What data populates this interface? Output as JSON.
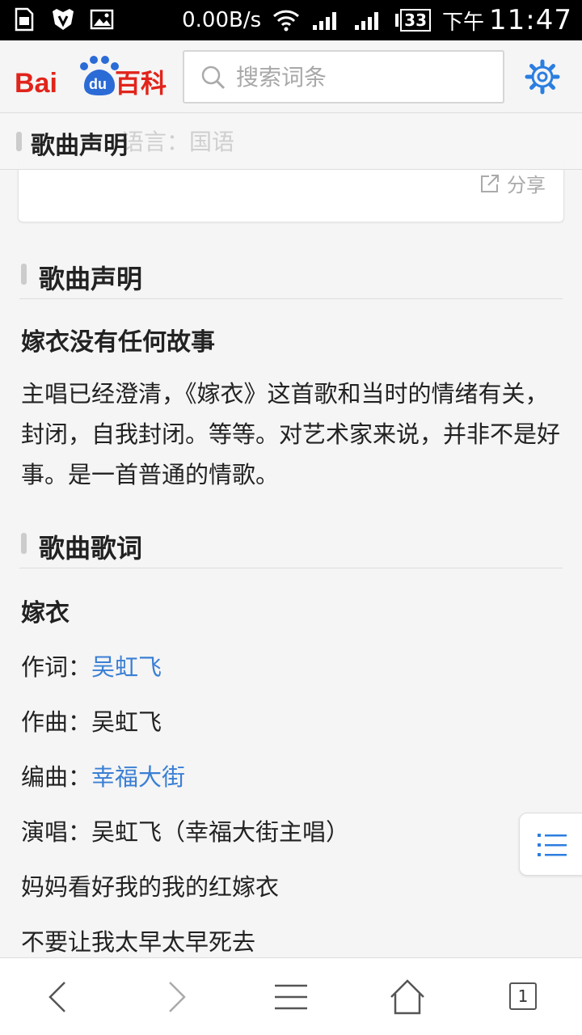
{
  "status_bar": {
    "net_speed": "0.00B/s",
    "battery": "33",
    "ampm": "下午",
    "time": "11:47"
  },
  "header": {
    "logo_text": "Bai du 百科",
    "search_placeholder": "搜索词条"
  },
  "sticky": {
    "ghost_text": "语言：国语",
    "title": "歌曲声明"
  },
  "card": {
    "share_label": "分享"
  },
  "section1": {
    "title": "歌曲声明",
    "subtitle": "嫁衣没有任何故事",
    "paragraph": "主唱已经澄清，《嫁衣》这首歌和当时的情绪有关，封闭，自我封闭。等等。对艺术家来说，并非不是好事。是一首普通的情歌。"
  },
  "section2": {
    "title": "歌曲歌词",
    "song_title": "嫁衣",
    "lyricist_label": "作词：",
    "lyricist": "吴虹飞",
    "composer_label": "作曲：",
    "composer": "吴虹飞",
    "arranger_label": "编曲：",
    "arranger": "幸福大街",
    "singer_label": "演唱：",
    "singer": "吴虹飞（幸福大街主唱）",
    "lyric_1": "妈妈看好我的我的红嫁衣",
    "lyric_2": "不要让我太早太早死去"
  },
  "bottom_nav": {
    "tab_count": "1"
  },
  "colors": {
    "link": "#3a7fd5",
    "brand_red": "#e1241b",
    "brand_blue": "#2b6bd6"
  }
}
